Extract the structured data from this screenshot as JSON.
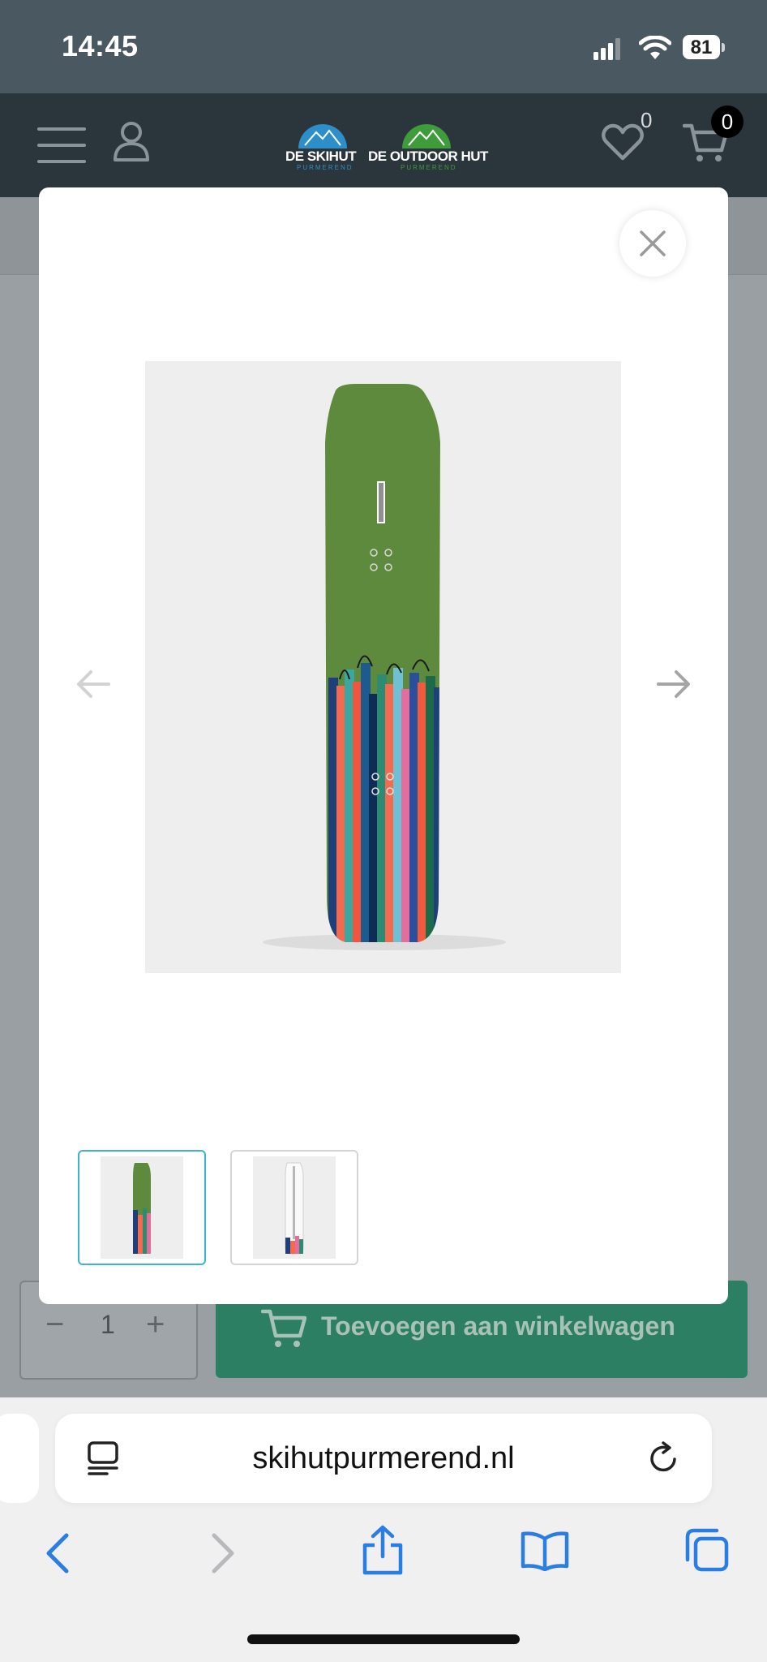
{
  "status_bar": {
    "time": "14:45",
    "battery_level": "81",
    "icons": [
      "cellular-signal-icon",
      "wifi-icon",
      "battery-icon"
    ]
  },
  "header": {
    "icons": [
      "hamburger-menu-icon",
      "user-account-icon",
      "heart-wishlist-icon",
      "shopping-cart-icon"
    ],
    "logo_skihut": "DE SKIHUT",
    "logo_skihut_sub": "PURMEREND",
    "logo_outdoor": "DE OUTDOOR HUT",
    "logo_outdoor_sub": "PURMEREND",
    "wishlist_count": "0",
    "cart_count": "0",
    "colors": {
      "background": "#2a353c",
      "logo_blue": "#2d8fc9",
      "logo_green": "#3f9c3a"
    }
  },
  "product_page": {
    "quantity": "1",
    "add_to_cart_label": "Toevoegen aan winkelwagen",
    "colors": {
      "add_to_cart": "#2c7f62"
    }
  },
  "lightbox": {
    "icons": [
      "close-icon",
      "arrow-left-icon",
      "arrow-right-icon"
    ],
    "active_thumbnail_index": 0,
    "thumbnails": [
      "snowboard-top-view",
      "snowboard-base-view"
    ],
    "colors": {
      "active_thumb_border": "#3bb3d6"
    }
  },
  "browser": {
    "url": "skihutpurmerend.nl",
    "icons": [
      "reader-mode-icon",
      "reload-icon",
      "back-icon",
      "forward-icon",
      "share-icon",
      "bookmarks-icon",
      "tabs-icon"
    ],
    "colors": {
      "accent": "#2a7de1"
    }
  }
}
